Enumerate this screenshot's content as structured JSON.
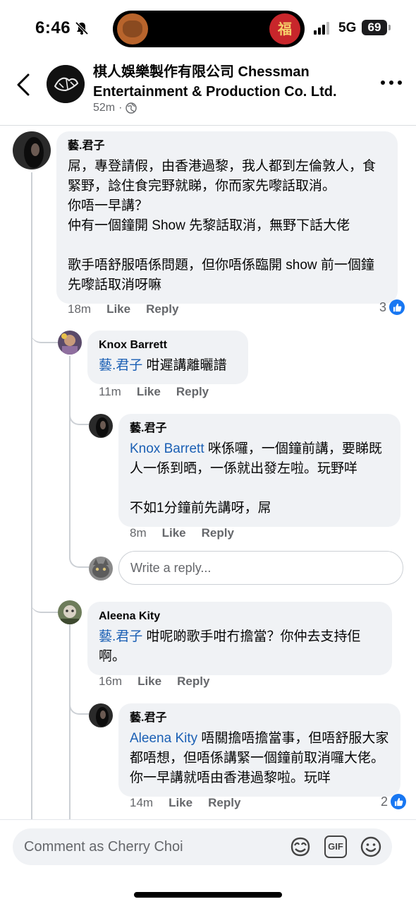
{
  "status_bar": {
    "time": "6:46",
    "network": "5G",
    "battery": "69",
    "fu_glyph": "福",
    "icons": [
      "bell-off-icon",
      "signal-icon"
    ]
  },
  "header": {
    "page_name": "棋人娛樂製作有限公司 Chessman Entertainment & Production Co. Ltd.",
    "meta_time": "52m",
    "meta_separator": "·",
    "icons": [
      "back-chevron-icon",
      "globe-icon",
      "more-icon"
    ]
  },
  "comments": [
    {
      "author": "藝.君子",
      "text": "屌，專登請假，由香港過黎，我人都到左倫敦人，食緊野，諗住食完野就睇，你而家先嚟話取消。\n你唔一早講？\n仲有一個鐘開 Show 先黎話取消，無野下話大佬\n\n歌手唔舒服唔係問題，但你唔係臨開 show 前一個鐘先嚟話取消呀嘛",
      "time": "18m",
      "like": "Like",
      "reply": "Reply",
      "reaction_count": "3",
      "replies": [
        {
          "author": "Knox Barrett",
          "mention": "藝.君子",
          "text": " 咁遲講離曬譜",
          "time": "11m",
          "like": "Like",
          "reply": "Reply"
        },
        {
          "author": "藝.君子",
          "mention": "Knox Barrett",
          "text": " 咪係囉，一個鐘前講，要睇既人一係到晒，一係就出發左啦。玩野咩\n\n不如1分鐘前先講呀，屌",
          "time": "8m",
          "like": "Like",
          "reply": "Reply"
        }
      ],
      "reply_placeholder": "Write a reply..."
    },
    {
      "author": "Aleena Kity",
      "mention": "藝.君子",
      "text": " 咁呢啲歌手咁冇擔當？你仲去支持佢啊。",
      "time": "16m",
      "like": "Like",
      "reply": "Reply",
      "replies": [
        {
          "author": "藝.君子",
          "mention": "Aleena Kity",
          "text": " 唔關擔唔擔當事，但唔舒服大家都唔想，但唔係講緊一個鐘前取消囉大佬。你一早講就唔由香港過黎啦。玩咩",
          "time": "14m",
          "like": "Like",
          "reply": "Reply",
          "reaction_count": "2"
        }
      ]
    }
  ],
  "composer": {
    "placeholder": "Comment as Cherry Choi",
    "icons": [
      "avatar-sticker-icon",
      "gif-icon",
      "emoji-icon"
    ],
    "gif_label": "GIF"
  },
  "colors": {
    "mention": "#1a5fb4",
    "bubble": "#f0f2f5",
    "like_blue": "#1877f2",
    "meta_gray": "#65676b"
  }
}
